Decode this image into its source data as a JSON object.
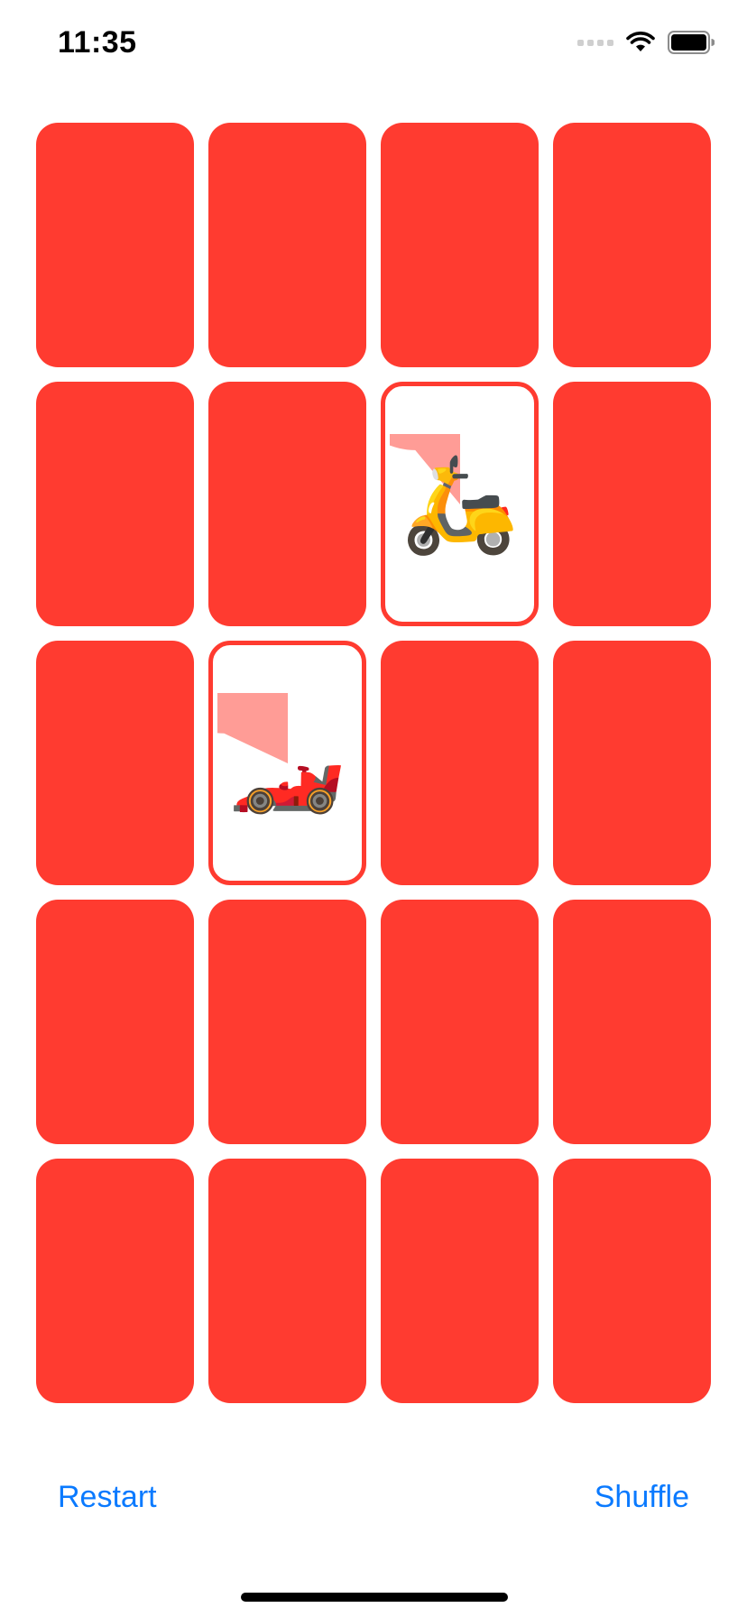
{
  "status_bar": {
    "time": "11:35",
    "icons": [
      "signal-icon",
      "wifi-icon",
      "battery-icon"
    ]
  },
  "game": {
    "card_back_color": "#ff3b30",
    "card_face_border_color": "#ff3b30",
    "pie_color": "#ff9c96",
    "rows": 5,
    "columns": 4,
    "cards": [
      {
        "state": "down"
      },
      {
        "state": "down"
      },
      {
        "state": "down"
      },
      {
        "state": "down"
      },
      {
        "state": "down"
      },
      {
        "state": "down"
      },
      {
        "state": "up",
        "content": "🛵",
        "icon": "scooter-icon",
        "remaining_fraction": 0.89
      },
      {
        "state": "down"
      },
      {
        "state": "down"
      },
      {
        "state": "up",
        "content": "🏎️",
        "icon": "race-car-icon",
        "remaining_fraction": 0.82
      },
      {
        "state": "down"
      },
      {
        "state": "down"
      },
      {
        "state": "down"
      },
      {
        "state": "down"
      },
      {
        "state": "down"
      },
      {
        "state": "down"
      },
      {
        "state": "down"
      },
      {
        "state": "down"
      },
      {
        "state": "down"
      },
      {
        "state": "down"
      }
    ]
  },
  "controls": {
    "restart_label": "Restart",
    "shuffle_label": "Shuffle",
    "button_color": "#0a7aff"
  }
}
